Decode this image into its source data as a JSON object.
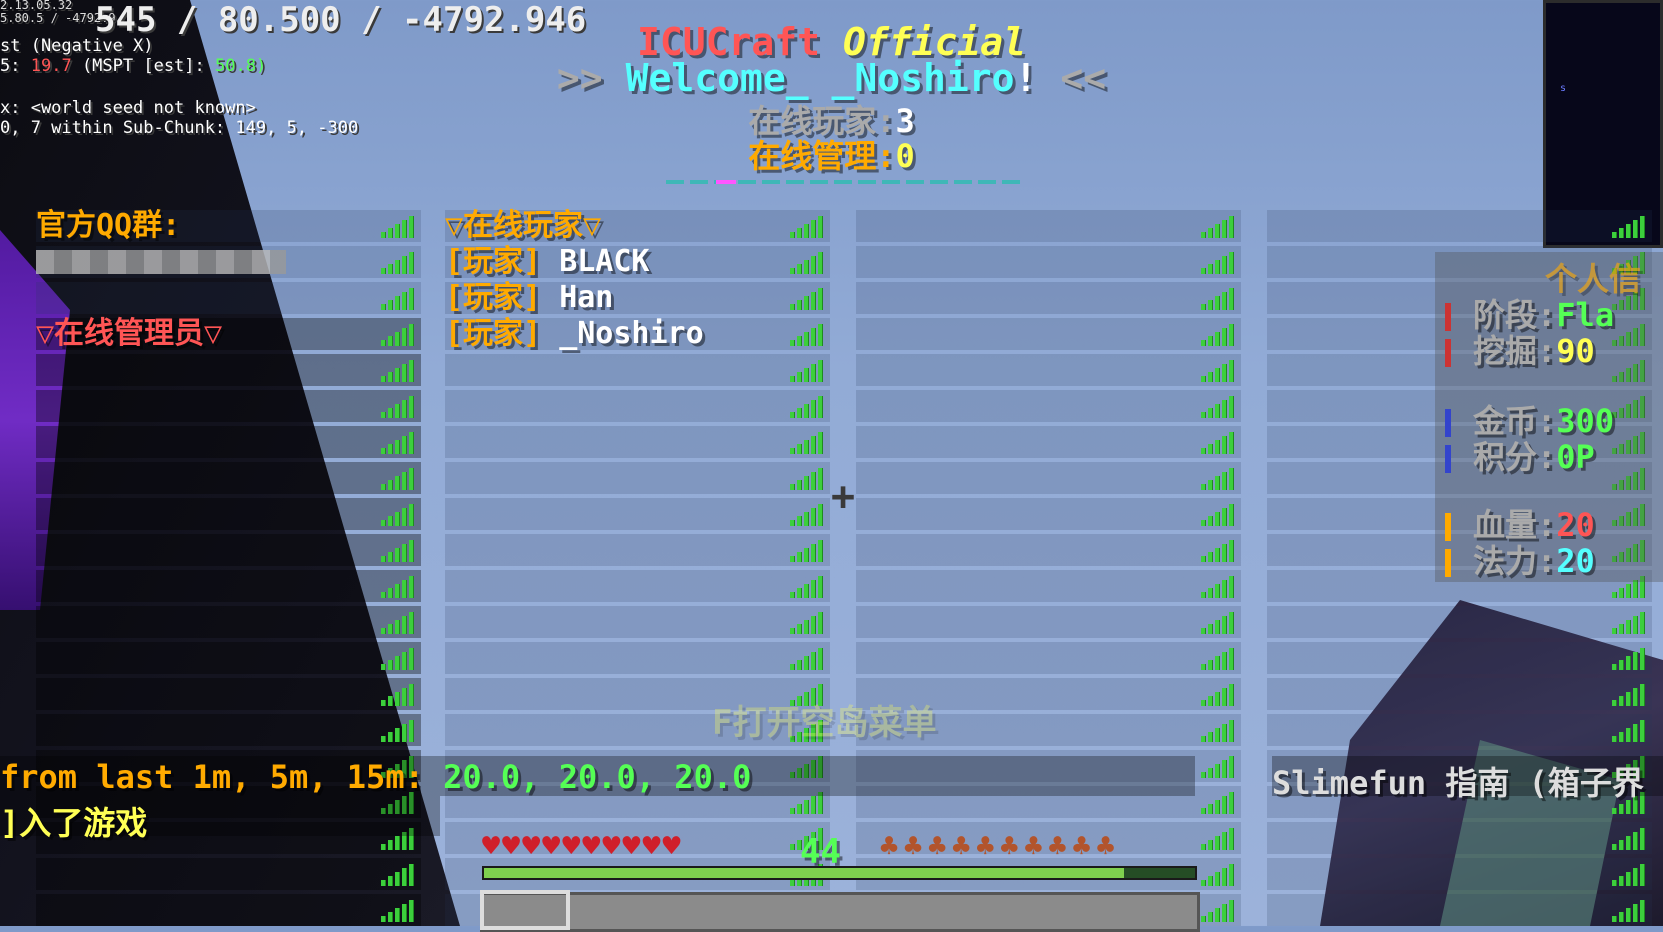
{
  "debug": {
    "coords": "545 / 80.500 / -4792.946",
    "line_small1": "2.13.05.32",
    "line_small2": "5.80.5 / -4792.9",
    "facing": "st (Negative X)",
    "tps_label": "5:",
    "tps": "19.7",
    "mspt_label": "(MSPT [est]:",
    "mspt": "50.8)",
    "seed": "x: <world seed not known>",
    "subchunk": "0, 7 within Sub-Chunk: 149, 5, -300"
  },
  "header": {
    "title_red": "ICUCraft",
    "title_yellow": "Official",
    "welcome_left": ">>",
    "welcome_text": "Welcome_",
    "welcome_name": "_Noshiro",
    "welcome_bang": "!",
    "welcome_right": "<<",
    "players_label": "在线玩家:",
    "players_count": "3",
    "admins_label": "在线管理:",
    "admins_count": "0"
  },
  "columns": {
    "col1": {
      "qq_label": "官方QQ群:",
      "admins_title": "▽在线管理员▽"
    },
    "col2": {
      "title": "▽在线玩家▽",
      "players": [
        {
          "tag": "[玩家]",
          "name": "BLACK"
        },
        {
          "tag": "[玩家]",
          "name": "Han"
        },
        {
          "tag": "[玩家]",
          "name": "_Noshiro"
        }
      ]
    }
  },
  "info_panel": {
    "title": "个人信",
    "stage_label": "阶段:",
    "stage_value": "Fla",
    "dig_label": "挖掘:",
    "dig_value": "90",
    "coin_label": "金币:",
    "coin_value": "300",
    "points_label": "积分:",
    "points_value": "0P",
    "hp_label": "血量:",
    "hp_value": "20",
    "mana_label": "法力:",
    "mana_value": "20"
  },
  "chat": {
    "line1_prefix": "from last 1m, 5m, 15m:",
    "line1_values": "20.0, 20.0, 20.0",
    "line2": "]入了游戏",
    "slimefun": "Slimefun 指南 (箱子界"
  },
  "actionbar": "F打开空岛菜单",
  "hud": {
    "hearts": "♥♥♥♥♥♥♥♥♥♥",
    "armor": "44",
    "food": "♣♣♣♣♣♣♣♣♣♣",
    "xp_fill": 0.9
  },
  "colors": {
    "red": "#ff5555",
    "yellow": "#ffff55",
    "aqua": "#55ffff",
    "gold": "#ffaa00",
    "green": "#55ff55"
  }
}
